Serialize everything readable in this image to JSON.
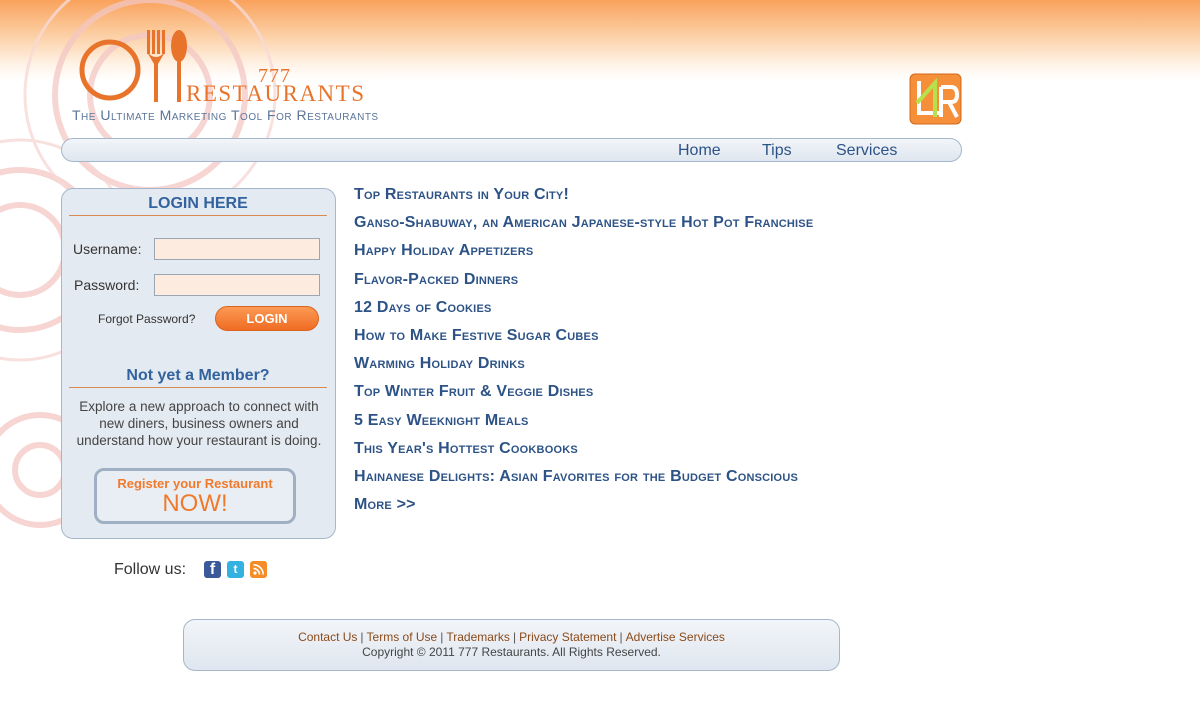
{
  "header": {
    "logo_number": "777",
    "logo_name": "RESTAURANTS",
    "tagline": "The Ultimate Marketing Tool For Restaurants"
  },
  "nav": {
    "home": "Home",
    "tips": "Tips",
    "services": "Services"
  },
  "login": {
    "title": "LOGIN HERE",
    "username_label": "Username:",
    "username_value": "",
    "password_label": "Password:",
    "password_value": "",
    "forgot": "Forgot Password?",
    "button": "LOGIN"
  },
  "member": {
    "title": "Not yet a Member?",
    "text": "Explore a new approach to connect with new diners, business owners and understand how your restaurant is doing.",
    "register_line1": "Register your Restaurant",
    "register_line2": "NOW!"
  },
  "social": {
    "label": "Follow us:",
    "icons": [
      "facebook-icon",
      "twitter-icon",
      "rss-icon"
    ]
  },
  "articles": [
    "Top Restaurants in Your City!",
    "Ganso-Shabuway, an American Japanese-style Hot Pot Franchise",
    "Happy Holiday Appetizers",
    "Flavor-Packed Dinners",
    "12 Days of Cookies",
    "How to Make Festive Sugar Cubes",
    "Warming Holiday Drinks",
    "Top Winter Fruit & Veggie Dishes",
    "5 Easy Weeknight Meals",
    "This Year's Hottest Cookbooks",
    "Hainanese Delights: Asian Favorites for the Budget Conscious",
    "More >>"
  ],
  "footer": {
    "links": [
      "Contact Us",
      "Terms of Use",
      "Trademarks",
      "Privacy Statement",
      "Advertise Services"
    ],
    "copyright": "Copyright © 2011 777 Restaurants. All Rights Reserved."
  },
  "colors": {
    "brand_orange": "#e8742b",
    "link_blue": "#2d5386",
    "panel_bg": "#e4eaf1"
  }
}
